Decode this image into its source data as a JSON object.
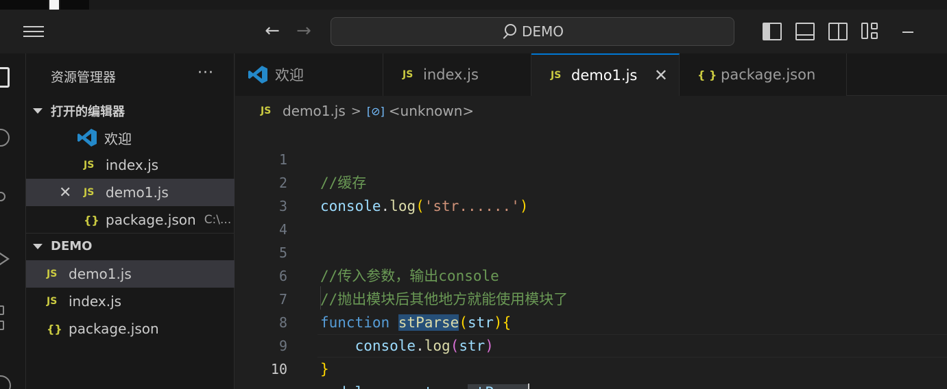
{
  "titlebar": {
    "search_text": "DEMO"
  },
  "sidebar": {
    "title": "资源管理器",
    "more": "···",
    "open_editors": {
      "title": "打开的编辑器",
      "items": [
        {
          "icon": "vscode-icon",
          "label": "欢迎"
        },
        {
          "icon": "JS",
          "label": "index.js"
        },
        {
          "icon": "JS",
          "label": "demo1.js",
          "close": "✕"
        },
        {
          "icon": "{}",
          "label": "package.json",
          "path": "C:\\..."
        }
      ]
    },
    "project": {
      "title": "DEMO",
      "items": [
        {
          "icon": "JS",
          "label": "demo1.js"
        },
        {
          "icon": "JS",
          "label": "index.js"
        },
        {
          "icon": "{}",
          "label": "package.json"
        }
      ]
    }
  },
  "tabs": [
    {
      "icon": "vscode-icon",
      "label": "欢迎"
    },
    {
      "icon": "JS",
      "label": "index.js"
    },
    {
      "icon": "JS",
      "label": "demo1.js",
      "close": "✕",
      "active": true
    },
    {
      "icon": "{ }",
      "label": "package.json"
    }
  ],
  "breadcrumb": {
    "icon": "JS",
    "file": "demo1.js",
    "sep": ">",
    "symbol_icon": "[⊘]",
    "symbol": "<unknown>"
  },
  "editor": {
    "line_numbers": [
      "1",
      "2",
      "3",
      "4",
      "5",
      "6",
      "7",
      "8",
      "9",
      "10"
    ],
    "lines": {
      "l1": "//缓存",
      "l2a": "console",
      "l2b": ".",
      "l2c": "log",
      "l2d": "(",
      "l2e": "'str......'",
      "l2f": ")",
      "l5": "//传入参数，输出console",
      "l6": "//抛出模块后其他地方就能使用模块了",
      "l7a": "function",
      "l7b": " ",
      "l7c": "stParse",
      "l7d": "(",
      "l7e": "str",
      "l7f": ")",
      "l7g": "{",
      "l8a": "    ",
      "l8b": "console",
      "l8c": ".",
      "l8d": "log",
      "l8e": "(",
      "l8f": "str",
      "l8g": ")",
      "l9": "}",
      "l10a": "module",
      "l10b": ".",
      "l10c": "exports",
      "l10d": " = ",
      "l10e": "stParse"
    }
  },
  "colors": {
    "accent": "#0078d4",
    "js_icon": "#cbcb41",
    "comment": "#6a9955",
    "keyword": "#569cd6",
    "string": "#ce9178"
  }
}
